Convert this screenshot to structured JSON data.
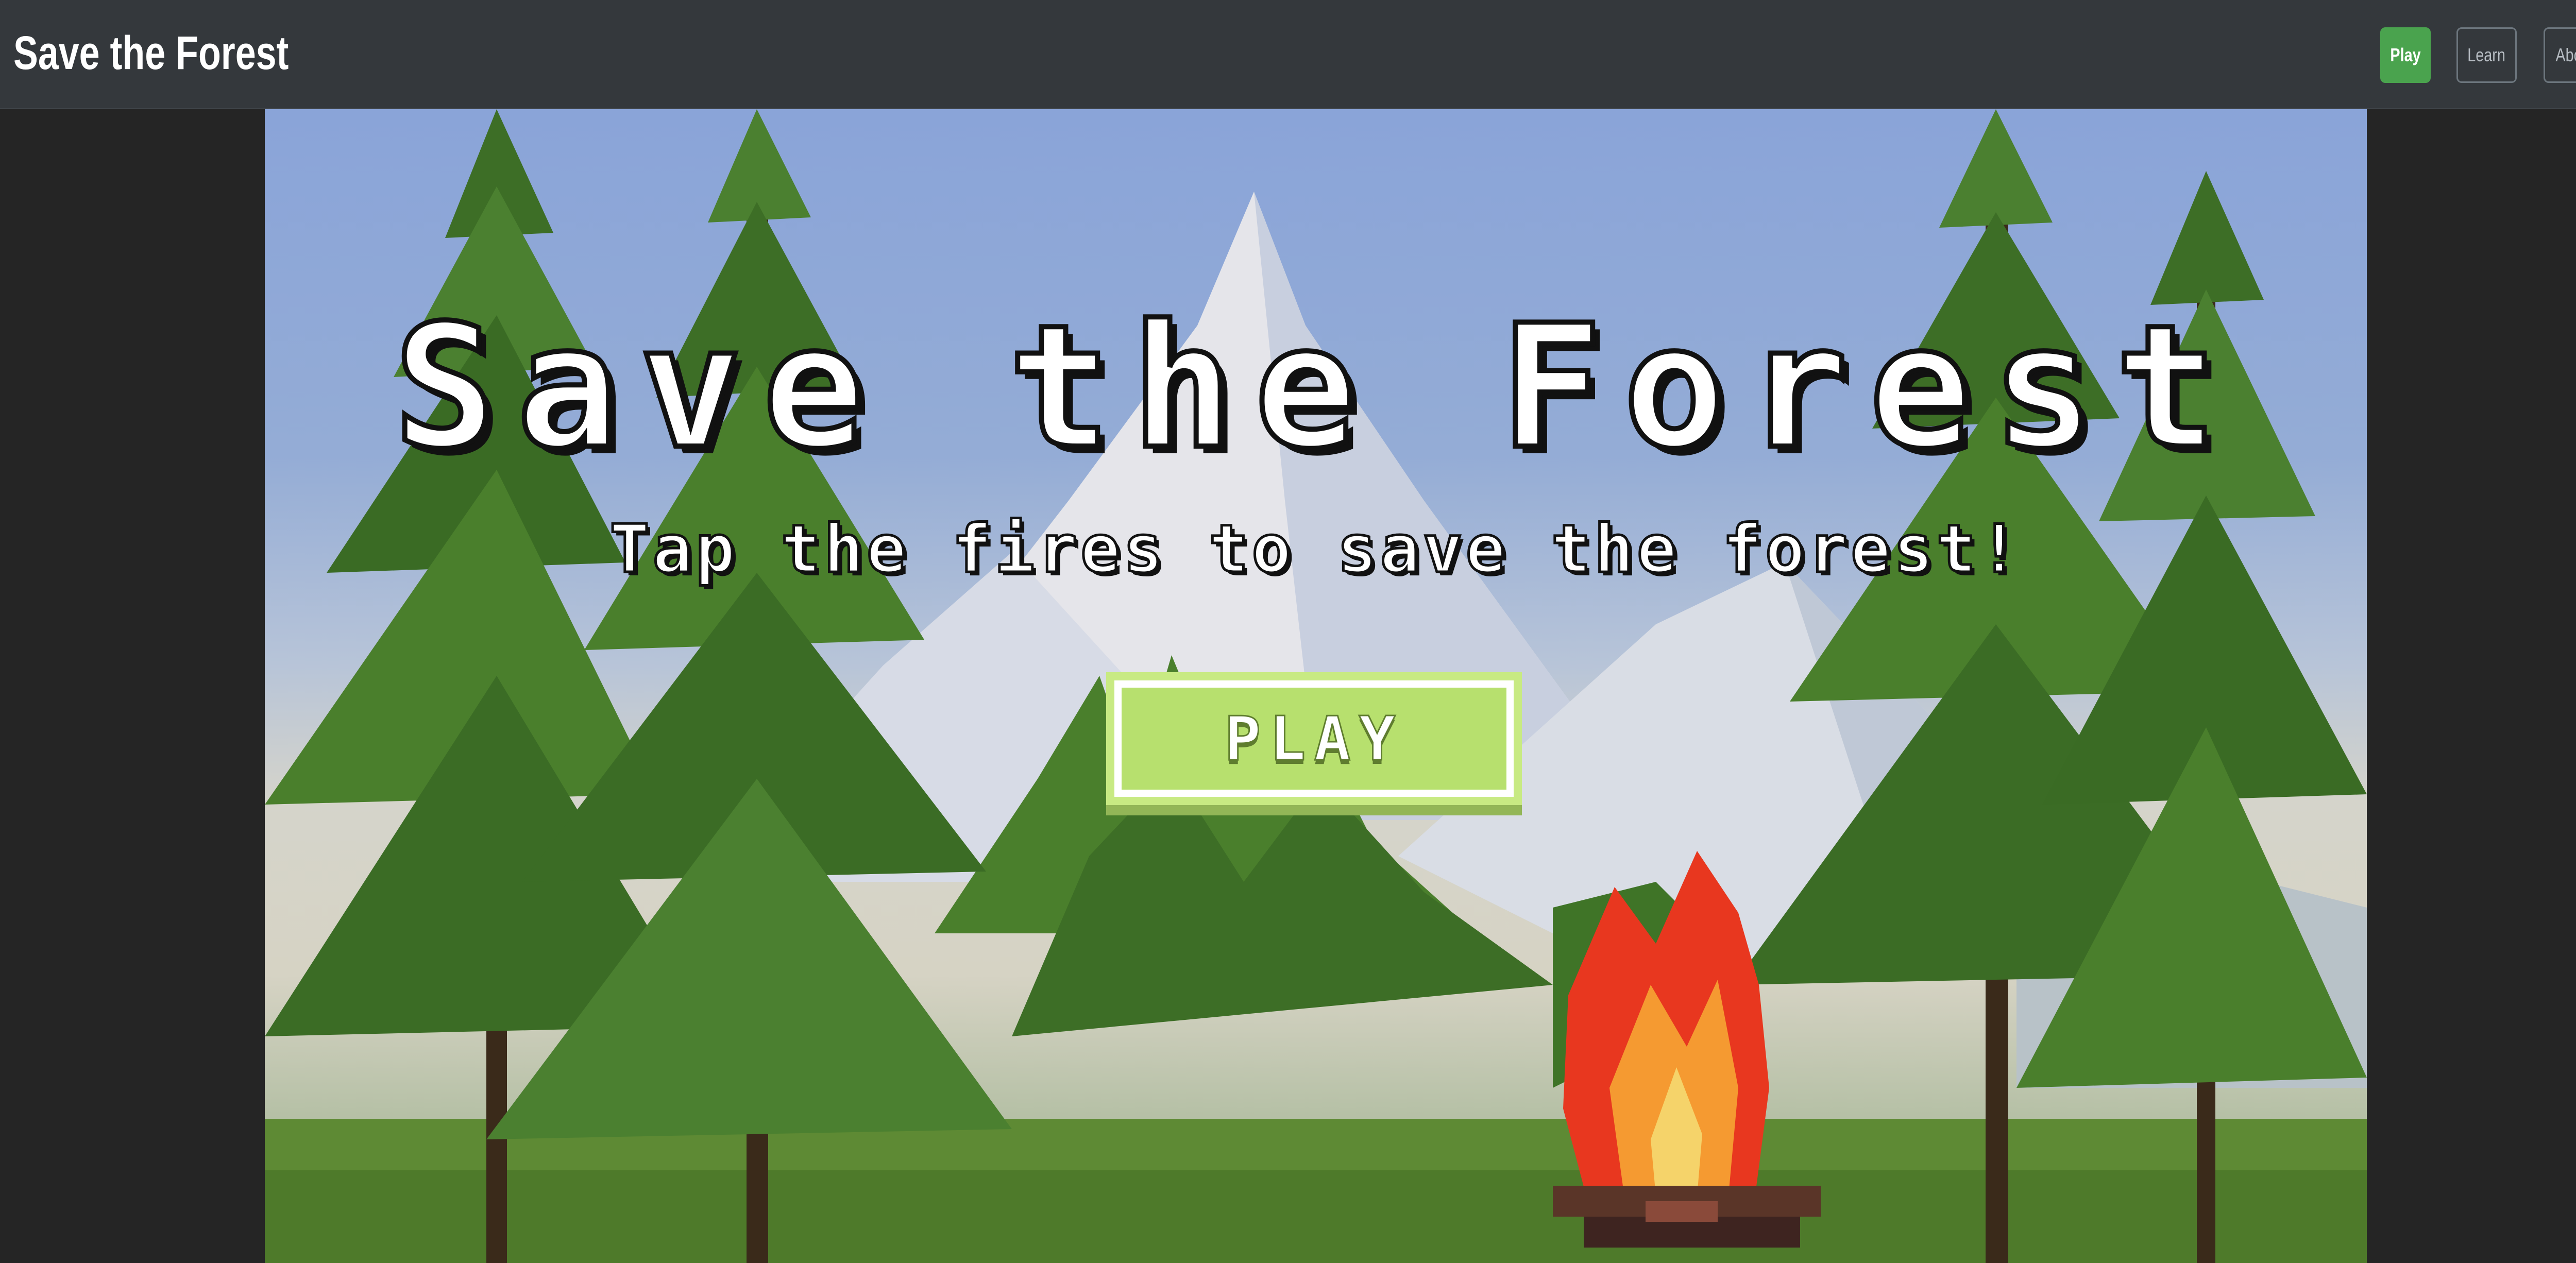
{
  "nav": {
    "brand": "Save the Forest",
    "buttons": [
      {
        "label": "Play",
        "active": true
      },
      {
        "label": "Learn",
        "active": false
      },
      {
        "label": "About",
        "active": false
      }
    ]
  },
  "game": {
    "title": "Save the Forest",
    "subtitle": "Tap the fires to save the forest!",
    "play_label": "PLAY",
    "scene_items": [
      "mountain",
      "pine-tree",
      "campfire",
      "grass"
    ]
  },
  "colors": {
    "navbar": "#34383c",
    "page_background": "#252525",
    "active_button": "#4aa34e",
    "play_button": "#b7e06e",
    "sky": "#8aa4d8",
    "tree_dark": "#2f5a1f",
    "tree_light": "#4f8a2c",
    "fire_red": "#e8371f",
    "fire_orange": "#f59a31",
    "fire_yellow": "#f5d36a"
  }
}
